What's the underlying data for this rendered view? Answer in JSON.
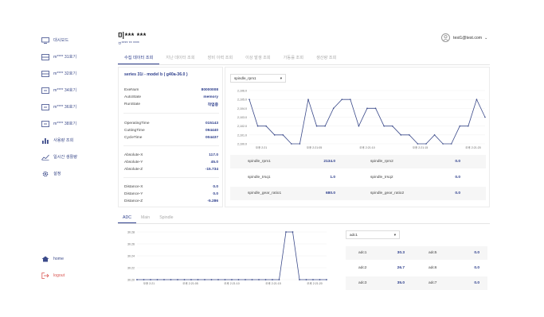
{
  "sidebar": {
    "items": [
      {
        "label": "대시보드",
        "icon": "monitor-icon"
      },
      {
        "label": "m**** 31호기",
        "icon": "machine-icon"
      },
      {
        "label": "m**** 32호기",
        "icon": "machine-icon"
      },
      {
        "label": "m**** 34호기",
        "icon": "machine-icon"
      },
      {
        "label": "m**** 36호기",
        "icon": "machine-icon"
      },
      {
        "label": "m**** 38호기",
        "icon": "machine-icon"
      },
      {
        "label": "사용량 조회",
        "icon": "bar-chart-icon"
      },
      {
        "label": "일시간 생활량",
        "icon": "line-chart-icon"
      },
      {
        "label": "설정",
        "icon": "gear-icon"
      }
    ],
    "home": "home",
    "logout": "logout"
  },
  "header": {
    "title": "미*** ***",
    "subtitle": "ㅂ**** ** ****"
  },
  "user": {
    "email": "test1@test.com"
  },
  "tabs": [
    "수집 데이터 조회",
    "지난 데이터 조회",
    "장비 이력 조회",
    "이상 발생 조회",
    "가동률 조회",
    "생산량 조회"
  ],
  "series_label": "series 31i - model b ( g40a-36.0 )",
  "machine_info": {
    "group1": [
      {
        "k": "ExeNum",
        "v": "80000008"
      },
      {
        "k": "AutoState",
        "v": "memory"
      },
      {
        "k": "RunState",
        "v": "작업중"
      }
    ],
    "group2": [
      {
        "k": "OperatingTime",
        "v": "015143"
      },
      {
        "k": "CuttingTime",
        "v": "094440"
      },
      {
        "k": "CycleTime",
        "v": "004437"
      }
    ],
    "group3": [
      {
        "k": "Absolute-X",
        "v": "117.0"
      },
      {
        "k": "Absolute-Y",
        "v": "45.0"
      },
      {
        "k": "Absolute-Z",
        "v": "-15.734"
      }
    ],
    "group4": [
      {
        "k": "Distance-X",
        "v": "0.0"
      },
      {
        "k": "Distance-Y",
        "v": "0.0"
      },
      {
        "k": "Distance-Z",
        "v": "-5.286"
      }
    ]
  },
  "spindle_select": "spindle_rpm1",
  "spindle_chart": {
    "y_ticks": [
      "2,106.0",
      "2,105.0",
      "2,104.0",
      "2,103.0",
      "2,102.0",
      "2,101.0",
      "2,100.0"
    ],
    "x_ticks": [
      "오후 2:21",
      "오후 2:21:05",
      "오후 2:21:10",
      "오후 2:21:15",
      "오후 2:21:20"
    ],
    "color": "#3b4a8a"
  },
  "spindle_table": [
    {
      "l1": "spindle_rpm1",
      "v1": "2134.0",
      "l2": "spindle_rpm2",
      "v2": "0.0"
    },
    {
      "l1": "spindle_trsq1",
      "v1": "1.0",
      "l2": "spindle_trsq2",
      "v2": "0.0"
    },
    {
      "l1": "spindle_gear_ratio1",
      "v1": "680.0",
      "l2": "spindle_gear_ratio2",
      "v2": "0.0"
    }
  ],
  "tabs2": [
    "ADC",
    "Main",
    "Spindle"
  ],
  "adc_chart": {
    "y_ticks": [
      "30.28",
      "30.26",
      "30.24",
      "30.22",
      "30.20"
    ],
    "x_ticks": [
      "오후 2:21",
      "오후 2:21:05",
      "오후 2:21:10",
      "오후 2:21:15",
      "오후 2:21:20"
    ]
  },
  "adc_select": "adc1",
  "adc_table": [
    {
      "l1": "adc1",
      "v1": "30.3",
      "l2": "adc5",
      "v2": "0.0"
    },
    {
      "l1": "adc2",
      "v1": "26.7",
      "l2": "adc6",
      "v2": "0.0"
    },
    {
      "l1": "adc3",
      "v1": "35.0",
      "l2": "adc7",
      "v2": "0.0"
    }
  ],
  "chart_data": [
    {
      "type": "line",
      "ylim": [
        2100,
        2106
      ],
      "series": [
        {
          "values": [
            2105,
            2102,
            2102,
            2101,
            2101,
            2100,
            2100,
            2105,
            2102,
            2102,
            2104,
            2105,
            2105,
            2102,
            2104,
            2104,
            2102,
            2102,
            2101,
            2101,
            2100,
            2100,
            2101,
            2100,
            2100,
            2102,
            2102,
            2105,
            2103
          ]
        }
      ]
    },
    {
      "type": "line",
      "ylim": [
        30.2,
        30.28
      ],
      "series": [
        {
          "values": [
            30.2,
            30.2,
            30.2,
            30.2,
            30.2,
            30.2,
            30.2,
            30.2,
            30.2,
            30.2,
            30.2,
            30.2,
            30.2,
            30.2,
            30.2,
            30.2,
            30.2,
            30.2,
            30.2,
            30.2,
            30.2,
            30.2,
            30.28,
            30.28,
            30.2,
            30.2,
            30.2,
            30.2,
            30.2
          ]
        }
      ]
    }
  ]
}
